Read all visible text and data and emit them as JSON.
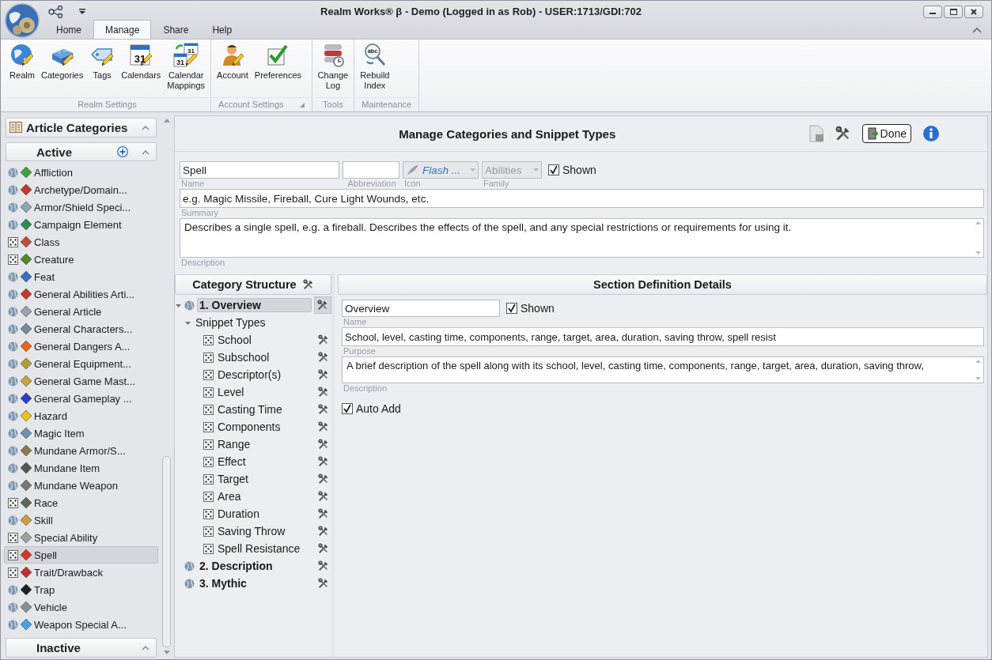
{
  "window": {
    "title": "Realm Works® β - Demo (Logged in as Rob) - USER:1713/GDI:702"
  },
  "ribbon": {
    "tabs": [
      {
        "label": "Home",
        "selected": false
      },
      {
        "label": "Manage",
        "selected": true
      },
      {
        "label": "Share",
        "selected": false
      },
      {
        "label": "Help",
        "selected": false
      }
    ],
    "groups": [
      {
        "label": "Realm Settings",
        "launcher": false,
        "buttons": [
          {
            "label": "Realm",
            "kind": "globe"
          },
          {
            "label": "Categories",
            "kind": "blocks"
          },
          {
            "label": "Tags",
            "kind": "tag"
          },
          {
            "label": "Calendars",
            "kind": "calendar",
            "icon_texts": [
              "31"
            ]
          },
          {
            "label": "Calendar\nMappings",
            "kind": "calendar-pair",
            "icon_texts": [
              "31",
              "31"
            ]
          }
        ]
      },
      {
        "label": "Account Settings",
        "launcher": true,
        "buttons": [
          {
            "label": "Account",
            "kind": "person"
          },
          {
            "label": "Preferences",
            "kind": "check"
          }
        ]
      },
      {
        "label": "Tools",
        "launcher": false,
        "buttons": [
          {
            "label": "Change\nLog",
            "kind": "database"
          }
        ]
      },
      {
        "label": "Maintenance",
        "launcher": false,
        "buttons": [
          {
            "label": "Rebuild\nIndex",
            "kind": "magnifier",
            "icon_texts": [
              "abc"
            ]
          }
        ]
      }
    ]
  },
  "sidebar": {
    "title": "Article Categories",
    "sections": [
      {
        "label": "Active",
        "items": [
          {
            "label": "Affliction",
            "kind": "globe",
            "selected": false
          },
          {
            "label": "Archetype/Domain...",
            "kind": "globe",
            "selected": false
          },
          {
            "label": "Armor/Shield Speci...",
            "kind": "globe",
            "selected": false
          },
          {
            "label": "Campaign Element",
            "kind": "globe",
            "selected": false
          },
          {
            "label": "Class",
            "kind": "dice",
            "selected": false
          },
          {
            "label": "Creature",
            "kind": "dice",
            "selected": false
          },
          {
            "label": "Feat",
            "kind": "globe",
            "selected": false
          },
          {
            "label": "General Abilities Arti...",
            "kind": "globe",
            "selected": false
          },
          {
            "label": "General Article",
            "kind": "globe",
            "selected": false
          },
          {
            "label": "General Characters...",
            "kind": "globe",
            "selected": false
          },
          {
            "label": "General Dangers A...",
            "kind": "globe",
            "selected": false
          },
          {
            "label": "General Equipment...",
            "kind": "globe",
            "selected": false
          },
          {
            "label": "General Game Mast...",
            "kind": "globe",
            "selected": false
          },
          {
            "label": "General Gameplay ...",
            "kind": "globe",
            "selected": false
          },
          {
            "label": "Hazard",
            "kind": "globe",
            "selected": false
          },
          {
            "label": "Magic Item",
            "kind": "globe",
            "selected": false
          },
          {
            "label": "Mundane Armor/S...",
            "kind": "globe",
            "selected": false
          },
          {
            "label": "Mundane Item",
            "kind": "globe",
            "selected": false
          },
          {
            "label": "Mundane Weapon",
            "kind": "globe",
            "selected": false
          },
          {
            "label": "Race",
            "kind": "dice",
            "selected": false
          },
          {
            "label": "Skill",
            "kind": "globe",
            "selected": false
          },
          {
            "label": "Special Ability",
            "kind": "dice",
            "selected": false
          },
          {
            "label": "Spell",
            "kind": "dice",
            "selected": true
          },
          {
            "label": "Trait/Drawback",
            "kind": "dice",
            "selected": false
          },
          {
            "label": "Trap",
            "kind": "globe",
            "selected": false
          },
          {
            "label": "Vehicle",
            "kind": "globe",
            "selected": false
          },
          {
            "label": "Weapon Special A...",
            "kind": "globe",
            "selected": false
          }
        ]
      },
      {
        "label": "Inactive"
      }
    ]
  },
  "manager": {
    "title": "Manage Categories and Snippet Types",
    "done_button": "Done",
    "save_disabled": true,
    "fields": {
      "name": {
        "value": "Spell",
        "label": "Name"
      },
      "abbreviation": {
        "label": "Abbreviation"
      },
      "icon": {
        "value": "Flash ...",
        "label": "Icon",
        "disabled": true
      },
      "family": {
        "value": "Abilities",
        "label": "Family",
        "disabled": true
      },
      "shown": {
        "label": "Shown",
        "checked": true
      },
      "summary": {
        "value": "e.g. Magic Missile, Fireball, Cure Light Wounds, etc.",
        "label": "Summary"
      },
      "description": {
        "value": "Describes a single spell, e.g. a fireball. Describes the effects of the spell, and any special restrictions or requirements for using it.",
        "label": "Description"
      }
    },
    "structure": {
      "title": "Category Structure",
      "sections": [
        {
          "label": "1. Overview",
          "kind": "globe",
          "selected": true,
          "expanded": true,
          "children": [
            {
              "label": "Snippet Types",
              "expanded": true,
              "children": [
                {
                  "label": "School",
                  "kind": "dice"
                },
                {
                  "label": "Subschool",
                  "kind": "dice"
                },
                {
                  "label": "Descriptor(s)",
                  "kind": "dice"
                },
                {
                  "label": "Level",
                  "kind": "dice"
                },
                {
                  "label": "Casting Time",
                  "kind": "dice"
                },
                {
                  "label": "Components",
                  "kind": "dice"
                },
                {
                  "label": "Range",
                  "kind": "dice"
                },
                {
                  "label": "Effect",
                  "kind": "dice"
                },
                {
                  "label": "Target",
                  "kind": "dice"
                },
                {
                  "label": "Area",
                  "kind": "dice"
                },
                {
                  "label": "Duration",
                  "kind": "dice"
                },
                {
                  "label": "Saving Throw",
                  "kind": "dice"
                },
                {
                  "label": "Spell Resistance",
                  "kind": "dice"
                }
              ]
            }
          ]
        },
        {
          "label": "2. Description",
          "kind": "globe",
          "selected": false
        },
        {
          "label": "3. Mythic",
          "kind": "globe",
          "selected": false
        }
      ]
    },
    "details": {
      "title": "Section Definition Details",
      "name": {
        "value": "Overview",
        "label": "Name"
      },
      "shown": {
        "label": "Shown",
        "checked": true
      },
      "purpose": {
        "value": "School, level, casting time, components, range, target, area, duration, saving throw, spell resist",
        "label": "Purpose"
      },
      "description": {
        "value": "A brief description of the spell along with its school, level, casting time, components, range, target, area, duration, saving throw,",
        "label": "Description"
      },
      "auto_add": {
        "label": "Auto Add",
        "checked": true
      }
    }
  }
}
